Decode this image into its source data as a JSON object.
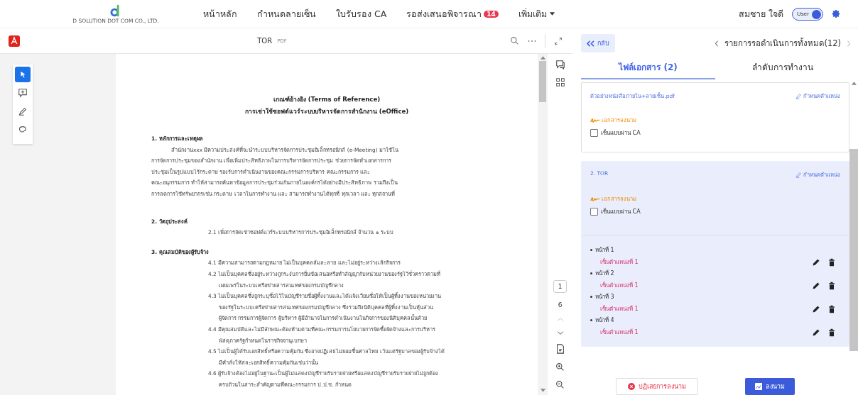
{
  "header": {
    "logo_text": "D SOLUTION DOT COM CO., LTD.",
    "nav": [
      {
        "label": "หน้าหลัก",
        "dropdown": false
      },
      {
        "label": "กำหนดลายเซ็น",
        "dropdown": false
      },
      {
        "label": "ใบรับรอง CA",
        "dropdown": false
      },
      {
        "label": "รอส่งเสนอพิจารณา",
        "badge": "14",
        "dropdown": false
      },
      {
        "label": "เพิ่มเติม",
        "dropdown": true
      }
    ],
    "user_name": "สมชาย ใจดี",
    "role_toggle": {
      "label": "User",
      "on": true
    }
  },
  "viewer": {
    "title": "TOR",
    "file_type": "PDF",
    "tools": [
      {
        "kind": "select",
        "selected": true
      },
      {
        "kind": "comment",
        "selected": false
      },
      {
        "kind": "draw",
        "selected": false
      },
      {
        "kind": "lasso",
        "selected": false
      }
    ],
    "document": [
      {
        "kind": "title",
        "lines": [
          "เกณฑ์อ้างอิง (Terms of Reference)",
          "การเช่าใช้ซอฟต์แวร์ระบบบริหารจัดการสำนักงาน (eOffice)"
        ]
      },
      {
        "kind": "heading",
        "lines": [
          "1. หลักการและเหตุผล"
        ]
      },
      {
        "kind": "paragraph",
        "lines": [
          "สำนักงานxxx  มีความประสงค์ที่จะนำระบบบริหารจัดการประชุมอิเล็กทรอนิกส์  (e-Meeting) มาใช้ใน",
          "การจัดการประชุมของสำนักงาน เพื่อเพิ่มประสิทธิภาพในการบริหารจัดการประชุม ช่วยการจัดทำเอกสารการ",
          "ประชุมเป็นรูปแบบไร้กระดาษ รองรับการดำเนินงานของคณะกรรมการบริหาร คณะกรรมการ และ",
          "คณะอนุกรรมการ ทำให้สามารถค้นหาข้อมูลการประชุมร่วมกันภายในองค์กรได้อย่างมีประสิทธิภาพ รวมถึงเป็น",
          "การลดการใช้ทรัพยากรเช่น กระดาษ เวลาในการทำงาน และ สามารถทำงานได้ทุกที่ ทุกเวลา และ ทุกสถานที่"
        ]
      },
      {
        "kind": "heading",
        "lines": [
          "2. วัตถุประสงค์"
        ]
      },
      {
        "kind": "item",
        "lines": [
          "2.1 เพื่อการจัดเช่าซอฟต์แวร์ระบบบริหารการประชุมอิเล็กทรอนิกส์ จำนวน ๑ ระบบ"
        ]
      },
      {
        "kind": "heading",
        "lines": [
          "3. คุณสมบัติของผู้รับจ้าง"
        ]
      },
      {
        "kind": "item",
        "lines": [
          "4.1 มีความสามารถตามกฎหมาย ไม่เป็นบุคคลล้มละลาย และไม่อยู่ระหว่างเลิกกิจการ"
        ]
      },
      {
        "kind": "item",
        "lines": [
          "4.2 ไม่เป็นบุคคลซึ่งอยู่ระหว่างถูกระงับการยื่นข้อเสนอหรือทำสัญญากับหน่วยงานของรัฐไว้ชั่วคราวตามที่",
          "เผยแพร่ในระบบเครือข่ายสารสนเทศของกรมบัญชีกลาง"
        ]
      },
      {
        "kind": "item",
        "lines": [
          "4.3 ไม่เป็นบุคคลซึ่งถูกระบุชื่อไว้ในบัญชีรายชื่อผู้ทิ้งงานและได้แจ้งเวียนชื่อให้เป็นผู้ทิ้งงานของหน่วยงาน",
          "ของรัฐในระบบเครือข่ายสารสนเทศของกรมบัญชีกลาง ซึ่งรวมถึงนิติบุคคลที่ผู้ทิ้งงานเป็นหุ้นส่วน",
          "ผู้จัดการ กรรมการผู้จัดการ ผู้บริหาร ผู้มีอำนาจในการดำเนินงานในกิจการของนิติบุคคลนั้นด้วย"
        ]
      },
      {
        "kind": "item",
        "lines": [
          "4.4 มีคุณสมบัติและไม่มีลักษณะต้องห้ามตามที่คณะกรรมการนโยบายการจัดซื้อจัดจ้างและการบริหาร",
          "พัสดุภาครัฐกำหนดในราชกิจจานุเบกษา"
        ]
      },
      {
        "kind": "item",
        "lines": [
          "4.5 ไม่เป็นผู้ได้รับเอกสิทธิ์หรือความคุ้มกัน ซึ่งอาจปฏิเสธไม่ยอมขึ้นศาลไทย เว้นแต่รัฐบาลของผู้รับจ้างได้",
          "มีคำสั่งให้สละเอกสิทธิ์ความคุ้มกันเช่นว่านั้น"
        ]
      },
      {
        "kind": "item",
        "lines": [
          "4.6 ผู้รับจ้างต้องไม่อยู่ในฐานะเป็นผู้ไม่แสดงบัญชีรายรับรายจ่ายหรือแสดงบัญชีรายรับรายจ่ายไม่ถูกต้อง",
          "ครบถ้วนในสาระสำคัญตามที่คณะกรรมการ ป.ป.ช. กำหนด"
        ]
      }
    ],
    "page_nav": {
      "current": "1",
      "total": "6"
    }
  },
  "panel": {
    "back": "กลับ",
    "pending": "รายการรอดำเนินการทั้งหมด(12)",
    "tabs": [
      {
        "label": "ไฟล์เอกสาร (2)",
        "selected": true
      },
      {
        "label": "ลำดับการทำงาน",
        "selected": false
      }
    ],
    "files": [
      {
        "name": "ตัวอย่างหนังสือภายใน+ลายเซ็น.pdf",
        "set_position": "กำหนดตำแหน่ง",
        "doc_type": "เอกสารลงนาม",
        "ca_label": "เซ็นแบบผ่าน CA",
        "ca_checked": false,
        "selected": false
      },
      {
        "name": "2. TOR",
        "set_position": "กำหนดตำแหน่ง",
        "doc_type": "เอกสารลงนาม",
        "ca_label": "เซ็นแบบผ่าน CA",
        "ca_checked": false,
        "selected": true,
        "pages": [
          {
            "page": "หน้าที่ 1",
            "positions": [
              "เซ็นตำแหน่งที่ 1"
            ]
          },
          {
            "page": "หน้าที่ 2",
            "positions": [
              "เซ็นตำแหน่งที่ 1"
            ]
          },
          {
            "page": "หน้าที่ 3",
            "positions": [
              "เซ็นตำแหน่งที่ 1"
            ]
          },
          {
            "page": "หน้าที่ 4",
            "positions": [
              "เซ็นตำแหน่งที่ 1"
            ]
          }
        ]
      }
    ],
    "reject": "ปฏิเสธการลงนาม",
    "sign": "ลงนาม"
  }
}
